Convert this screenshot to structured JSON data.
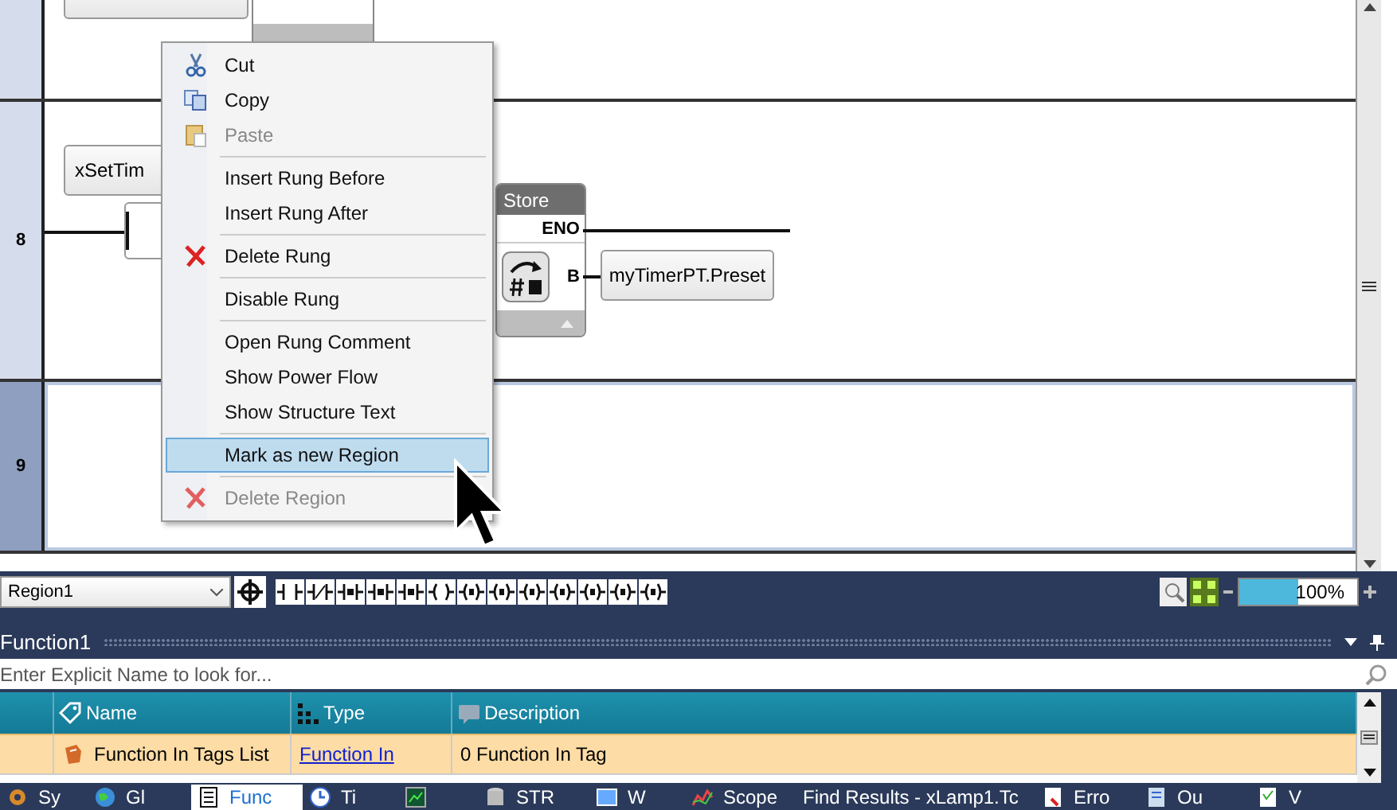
{
  "ladder": {
    "rungs": [
      {
        "kind": "partial",
        "selected": false
      },
      {
        "kind": "block",
        "number": "8",
        "selected": false,
        "tag": "xSetTim",
        "block": {
          "title": "Store",
          "output": "ENO",
          "pin": "B",
          "target": "myTimerPT.Preset"
        }
      },
      {
        "kind": "empty",
        "number": "9",
        "selected": true
      }
    ]
  },
  "context_menu": {
    "items": [
      {
        "kind": "cut",
        "label": "Cut",
        "disabled": false,
        "selected": false
      },
      {
        "kind": "copy",
        "label": "Copy",
        "disabled": false,
        "selected": false
      },
      {
        "kind": "paste",
        "label": "Paste",
        "disabled": true,
        "selected": false
      },
      {
        "kind": "separator"
      },
      {
        "kind": "plain",
        "label": "Insert Rung Before",
        "disabled": false,
        "selected": false
      },
      {
        "kind": "plain",
        "label": "Insert Rung After",
        "disabled": false,
        "selected": false
      },
      {
        "kind": "separator"
      },
      {
        "kind": "delete",
        "label": "Delete Rung",
        "disabled": false,
        "selected": false
      },
      {
        "kind": "separator"
      },
      {
        "kind": "plain",
        "label": "Disable Rung",
        "disabled": false,
        "selected": false
      },
      {
        "kind": "separator"
      },
      {
        "kind": "plain",
        "label": "Open Rung Comment",
        "disabled": false,
        "selected": false
      },
      {
        "kind": "plain",
        "label": "Show Power Flow",
        "disabled": false,
        "selected": false
      },
      {
        "kind": "plain",
        "label": "Show Structure Text",
        "disabled": false,
        "selected": false
      },
      {
        "kind": "separator"
      },
      {
        "kind": "plain",
        "label": "Mark as new Region",
        "disabled": false,
        "selected": true
      },
      {
        "kind": "separator"
      },
      {
        "kind": "delete",
        "label": "Delete Region",
        "disabled": true,
        "selected": false
      }
    ]
  },
  "toolbar": {
    "region_dropdown": "Region1",
    "zoom": {
      "value": "100%",
      "level": 0.5
    }
  },
  "panel": {
    "title": "Function1",
    "search": {
      "placeholder": "Enter Explicit Name to look for..."
    },
    "table": {
      "columns": [
        {
          "label": "Name"
        },
        {
          "label": "Type"
        },
        {
          "label": "Description"
        }
      ],
      "rows": [
        {
          "selected": true,
          "cells": [
            "Function In Tags List",
            "Function In",
            "0 Function In Tag"
          ]
        }
      ]
    }
  },
  "bottom_tabs": [
    {
      "label": "Sy",
      "selected": false
    },
    {
      "label": "Gl",
      "selected": false
    },
    {
      "label": "Func",
      "selected": true
    },
    {
      "label": "Ti",
      "selected": false
    },
    {
      "selected": false
    },
    {
      "label": "STR",
      "selected": false
    },
    {
      "label": "W",
      "selected": false
    },
    {
      "label": "Scope",
      "selected": false
    },
    {
      "label": "Find Results - xLamp1.Tc",
      "selected": false
    },
    {
      "label": "Erro",
      "selected": false
    },
    {
      "label": "Ou",
      "selected": false
    },
    {
      "label": "V",
      "selected": false
    }
  ]
}
